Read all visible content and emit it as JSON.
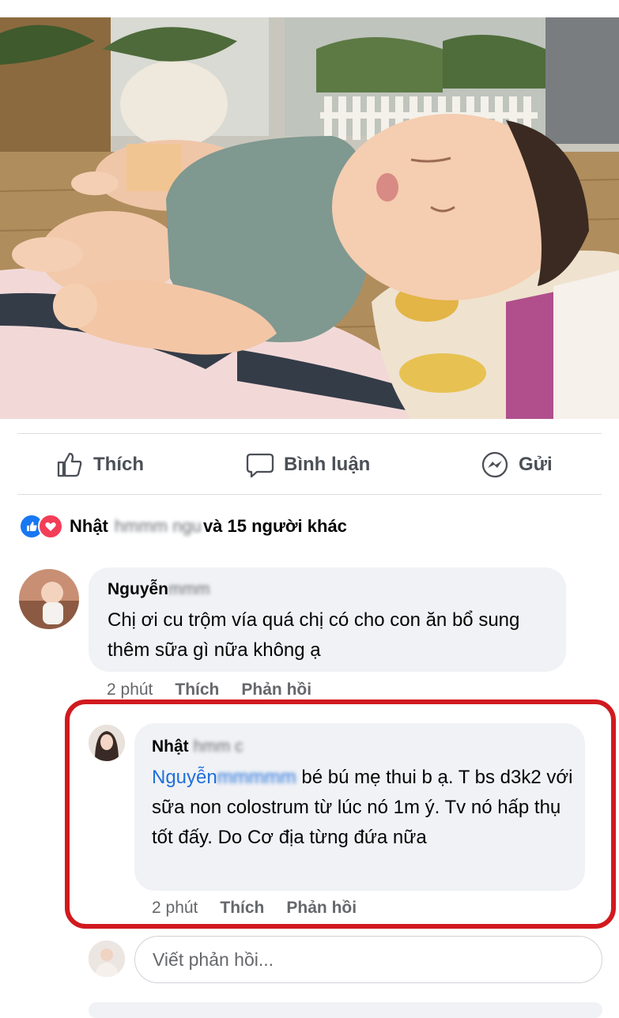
{
  "actions": {
    "like_label": "Thích",
    "comment_label": "Bình luận",
    "send_label": "Gửi"
  },
  "reactions": {
    "name_visible": "Nhật",
    "name_blurred": "hmmm ngu",
    "suffix": "và 15 người khác"
  },
  "comments": [
    {
      "author_visible": "Nguyễn",
      "author_blurred": "mmm",
      "text": "Chị ơi cu trộm vía quá chị có cho con ăn bổ sung thêm sữa gì nữa không ạ",
      "time": "2 phút",
      "like_label": "Thích",
      "reply_label": "Phản hồi"
    }
  ],
  "reply": {
    "author_visible": "Nhật",
    "author_blurred": "hmm c",
    "mention_visible": "Nguyễn",
    "mention_blurred": "mmmmm",
    "text": "bé bú mẹ thui b ạ. T bs d3k2 với sữa non colostrum từ lúc nó 1m ý. Tv nó hấp thụ tốt đấy. Do Cơ địa từng đứa nữa",
    "time": "2 phút",
    "like_label": "Thích",
    "reply_label": "Phản hồi"
  },
  "reply_input": {
    "placeholder": "Viết phản hồi..."
  },
  "colors": {
    "highlight": "#d11a1f",
    "like_blue": "#1877f2",
    "love_red": "#f33e58",
    "bubble": "#f0f2f5",
    "mention": "#216fdb"
  },
  "icons": {
    "like": "thumbs-up-icon",
    "comment": "speech-bubble-icon",
    "send": "messenger-icon"
  }
}
